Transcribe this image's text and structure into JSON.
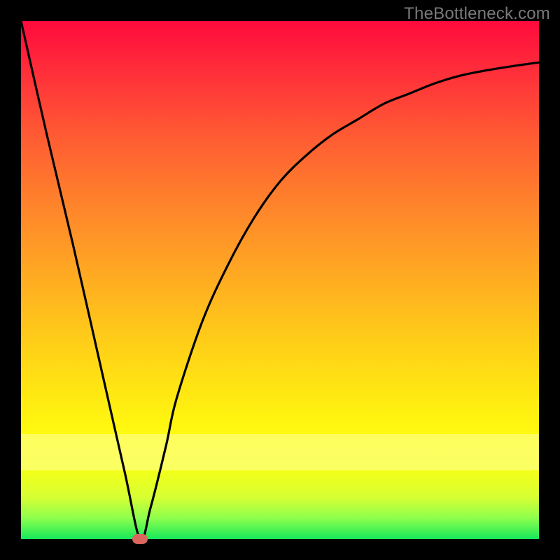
{
  "watermark": "TheBottleneck.com",
  "chart_data": {
    "type": "line",
    "title": "",
    "xlabel": "",
    "ylabel": "",
    "xlim": [
      0,
      100
    ],
    "ylim": [
      0,
      100
    ],
    "grid": false,
    "x": [
      0,
      5,
      10,
      15,
      20,
      23,
      25,
      28,
      30,
      35,
      40,
      45,
      50,
      55,
      60,
      65,
      70,
      75,
      80,
      85,
      90,
      95,
      100
    ],
    "values": [
      100,
      78,
      57,
      35,
      13,
      0,
      6,
      18,
      27,
      42,
      53,
      62,
      69,
      74,
      78,
      81,
      84,
      86,
      88,
      89.5,
      90.5,
      91.3,
      92
    ],
    "marker": {
      "x": 23,
      "y": 0
    }
  },
  "colors": {
    "curve": "#000000",
    "marker": "#d9675e",
    "gradient_top": "#ff0a3c",
    "gradient_bottom": "#16e85a"
  }
}
